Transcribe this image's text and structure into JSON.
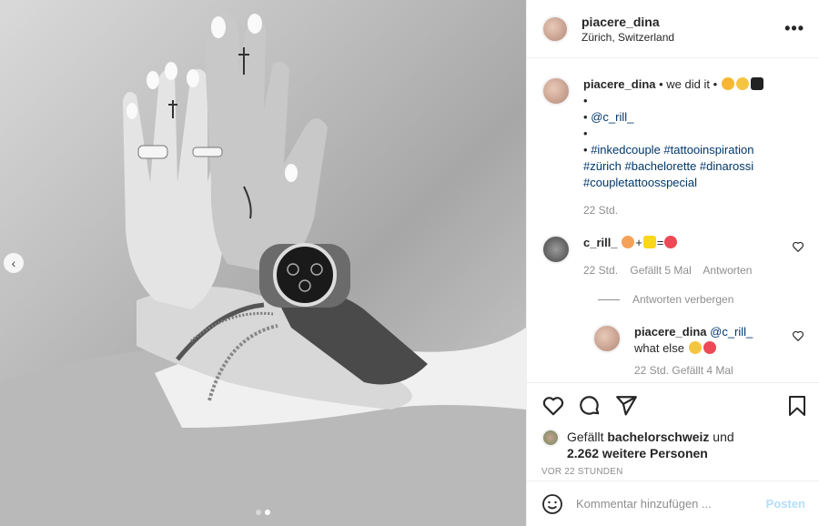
{
  "header": {
    "username": "piacere_dina",
    "location": "Zürich, Switzerland",
    "more": "•••"
  },
  "caption": {
    "username": "piacere_dina",
    "text": " • we did it • ",
    "line_bullet": "•",
    "mention": "@c_rill_",
    "hashtags_line1": "#inkedcouple #tattooinspiration",
    "hashtags_line2": "#zürich #bachelorette #dinarossi",
    "hashtags_line3": "#coupletattoosspecial",
    "time": "22 Std."
  },
  "comment": {
    "username": "c_rill_",
    "plus": "+",
    "equals": "=",
    "time": "22 Std.",
    "likes": "Gefällt 5 Mal",
    "reply_label": "Antworten"
  },
  "hide_replies": "Antworten verbergen",
  "reply": {
    "username": "piacere_dina",
    "mention": "@c_rill_",
    "text": "what else",
    "meta_cut": "22 Std.   Gefällt 4 Mal"
  },
  "likes": {
    "prefix": "Gefällt ",
    "user": "bachelorschweiz",
    "connector": " und",
    "count_text": "2.262 weitere Personen"
  },
  "posted": "VOR 22 STUNDEN",
  "comment_input": {
    "placeholder": "Kommentar hinzufügen ...",
    "post_label": "Posten"
  },
  "media": {
    "slides": 2,
    "active_slide": 2,
    "prev": "‹"
  },
  "colors": {
    "link": "#00376b",
    "muted": "#8e8e8e",
    "heart": "#ed4956",
    "post_disabled": "#b2dffc"
  }
}
